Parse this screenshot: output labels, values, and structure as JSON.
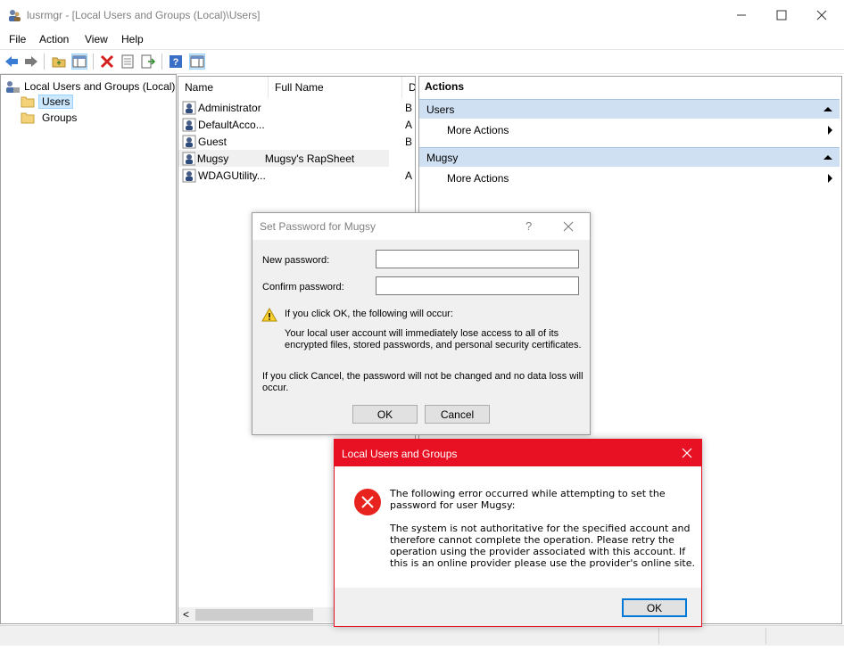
{
  "window": {
    "title": "lusrmgr - [Local Users and Groups (Local)\\Users]"
  },
  "menu": [
    "File",
    "Action",
    "View",
    "Help"
  ],
  "tree": {
    "root": "Local Users and Groups (Local)",
    "children": [
      "Users",
      "Groups"
    ]
  },
  "list": {
    "headers": [
      "Name",
      "Full Name",
      "D"
    ],
    "rows": [
      {
        "name": "Administrator",
        "full_name": "",
        "desc": "B"
      },
      {
        "name": "DefaultAcco...",
        "full_name": "",
        "desc": "A"
      },
      {
        "name": "Guest",
        "full_name": "",
        "desc": "B"
      },
      {
        "name": "Mugsy",
        "full_name": "Mugsy's RapSheet",
        "desc": ""
      },
      {
        "name": "WDAGUtility...",
        "full_name": "",
        "desc": "A"
      }
    ],
    "scroll_left": "<"
  },
  "actions": {
    "title": "Actions",
    "sections": [
      {
        "header": "Users",
        "item": "More Actions"
      },
      {
        "header": "Mugsy",
        "item": "More Actions"
      }
    ]
  },
  "password_dialog": {
    "title": "Set Password for Mugsy",
    "help": "?",
    "new_password_label": "New password:",
    "confirm_password_label": "Confirm password:",
    "new_password_value": "",
    "confirm_password_value": "",
    "warning_heading": "If you click OK, the following will occur:",
    "warning_line1": "Your local user account will immediately lose access to all of its",
    "warning_line2": "encrypted files, stored passwords, and personal security certificates.",
    "cancel_line1": "If you click Cancel, the password will not be changed and no data loss will",
    "cancel_line2": "occur.",
    "ok_label": "OK",
    "cancel_label": "Cancel"
  },
  "error_dialog": {
    "title": "Local Users and Groups",
    "line1": "The following error occurred while attempting to set the",
    "line2": "password for user Mugsy:",
    "line3": "The system is not authoritative for the specified account and",
    "line4": "therefore cannot complete the operation. Please retry the",
    "line5": "operation using the provider associated with this account. If",
    "line6": "this is an online provider please use the provider's online site.",
    "ok_label": "OK"
  },
  "colors": {
    "error_red": "#e81123",
    "action_header": "#cfe0f3",
    "selection": "#cce8ff"
  }
}
